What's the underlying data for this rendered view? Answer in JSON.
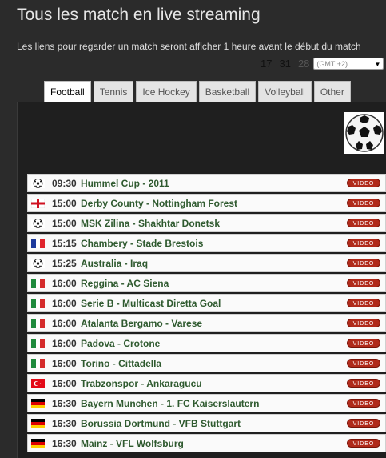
{
  "header": {
    "title": "Tous les match en live streaming",
    "subtitle": "Les liens pour regarder un match seront afficher 1 heure avant le début du match"
  },
  "dates": [
    "17",
    "31",
    "28"
  ],
  "timezone": {
    "value": "(GMT +2)"
  },
  "tabs": [
    {
      "label": "Football",
      "active": true
    },
    {
      "label": "Tennis",
      "active": false
    },
    {
      "label": "Ice Hockey",
      "active": false
    },
    {
      "label": "Basketball",
      "active": false
    },
    {
      "label": "Volleyball",
      "active": false
    },
    {
      "label": "Other",
      "active": false
    }
  ],
  "video_label": "VIDEO",
  "matches": [
    {
      "flag": "ball-icon",
      "time": "09:30",
      "name": "Hummel Cup - 2011"
    },
    {
      "flag": "england-flag-icon",
      "time": "15:00",
      "name": "Derby County - Nottingham Forest"
    },
    {
      "flag": "ball-icon",
      "time": "15:00",
      "name": "MSK Zilina - Shakhtar Donetsk"
    },
    {
      "flag": "france-flag-icon",
      "time": "15:15",
      "name": "Chambery - Stade Brestois"
    },
    {
      "flag": "ball-icon",
      "time": "15:25",
      "name": "Australia - Iraq"
    },
    {
      "flag": "italy-flag-icon",
      "time": "16:00",
      "name": "Reggina - AC Siena"
    },
    {
      "flag": "italy-flag-icon",
      "time": "16:00",
      "name": "Serie B - Multicast Diretta Goal"
    },
    {
      "flag": "italy-flag-icon",
      "time": "16:00",
      "name": "Atalanta Bergamo - Varese"
    },
    {
      "flag": "italy-flag-icon",
      "time": "16:00",
      "name": "Padova - Crotone"
    },
    {
      "flag": "italy-flag-icon",
      "time": "16:00",
      "name": "Torino - Cittadella"
    },
    {
      "flag": "turkey-flag-icon",
      "time": "16:00",
      "name": "Trabzonspor - Ankaragucu"
    },
    {
      "flag": "germany-flag-icon",
      "time": "16:30",
      "name": "Bayern Munchen - 1. FC Kaiserslautern"
    },
    {
      "flag": "germany-flag-icon",
      "time": "16:30",
      "name": "Borussia Dortmund - VFB Stuttgart"
    },
    {
      "flag": "germany-flag-icon",
      "time": "16:30",
      "name": "Mainz - VFL Wolfsburg"
    }
  ]
}
